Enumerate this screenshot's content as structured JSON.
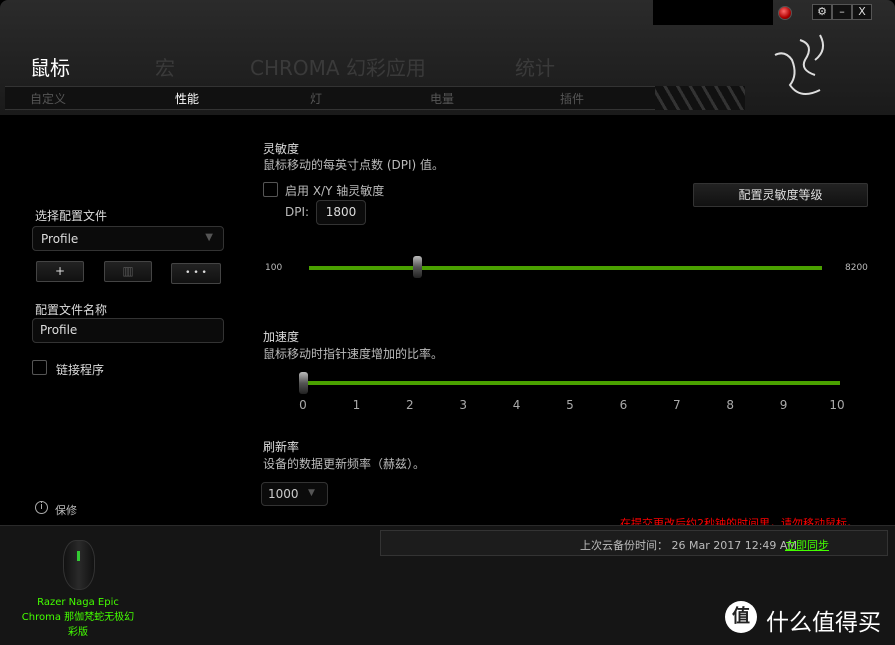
{
  "window": {
    "settings_icon": "gear-icon",
    "minimize_label": "–",
    "close_label": "X",
    "record_icon": "red-record-icon"
  },
  "main_tabs": [
    {
      "label": "鼠标",
      "active": true
    },
    {
      "label": "宏"
    },
    {
      "label": "CHROMA 幻彩应用"
    },
    {
      "label": "统计"
    }
  ],
  "sub_tabs": [
    {
      "label": "自定义"
    },
    {
      "label": "性能",
      "active": true
    },
    {
      "label": "灯"
    },
    {
      "label": "电量"
    },
    {
      "label": "插件"
    }
  ],
  "profile": {
    "select_label": "选择配置文件",
    "selected": "Profile",
    "add_label": "+",
    "delete_icon": "trash-icon",
    "more_label": "• • •",
    "name_label": "配置文件名称",
    "name_value": "Profile",
    "link_program_label": "链接程序",
    "link_program_checked": false,
    "repair_label": "保修",
    "repair_icon": "info-icon"
  },
  "sensitivity": {
    "title": "灵敏度",
    "desc": "鼠标移动的每英寸点数 (DPI) 值。",
    "xy_label": "启用 X/Y 轴灵敏度",
    "xy_checked": false,
    "dpi_label": "DPI:",
    "dpi_value": "1800",
    "configure_button": "配置灵敏度等级",
    "min_label": "100",
    "max_label": "8200",
    "min": 100,
    "max": 8200,
    "value": 1800
  },
  "acceleration": {
    "title": "加速度",
    "desc": "鼠标移动时指针速度增加的比率。",
    "ticks": [
      "0",
      "1",
      "2",
      "3",
      "4",
      "5",
      "6",
      "7",
      "8",
      "9",
      "10"
    ],
    "value": 0
  },
  "polling": {
    "title": "刷新率",
    "desc": "设备的数据更新频率（赫兹）。",
    "value": "1000"
  },
  "footer": {
    "warning": "在提交更改后约2秒钟的时间里，请勿移动鼠标。",
    "backup_text": "上次云备份时间： 26 Mar 2017 12:49 AM",
    "sync_link": "立即同步",
    "device_name": "Razer Naga Epic Chroma 那伽梵蛇无极幻彩版",
    "watermark": "什么值得买",
    "watermark_badge": "值"
  },
  "colors": {
    "accent": "#4aa000",
    "device_name": "#44ff00",
    "warning": "#ff0000",
    "link": "#44ff00"
  }
}
